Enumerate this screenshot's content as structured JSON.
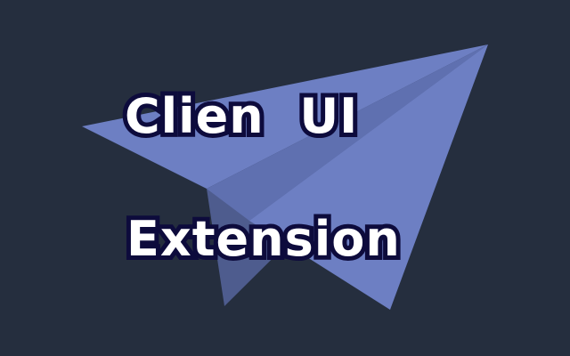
{
  "banner": {
    "title_line_1": "Clien  UI",
    "title_line_2": "Extension",
    "colors": {
      "background": "#252e3e",
      "plane_main": "#6d7fc3",
      "plane_shadow": "#4e5c8e",
      "plane_fold": "#5f70b0",
      "text_fill": "#ffffff",
      "text_outline": "#0d0b3c"
    },
    "icon": "paper-plane-icon"
  }
}
